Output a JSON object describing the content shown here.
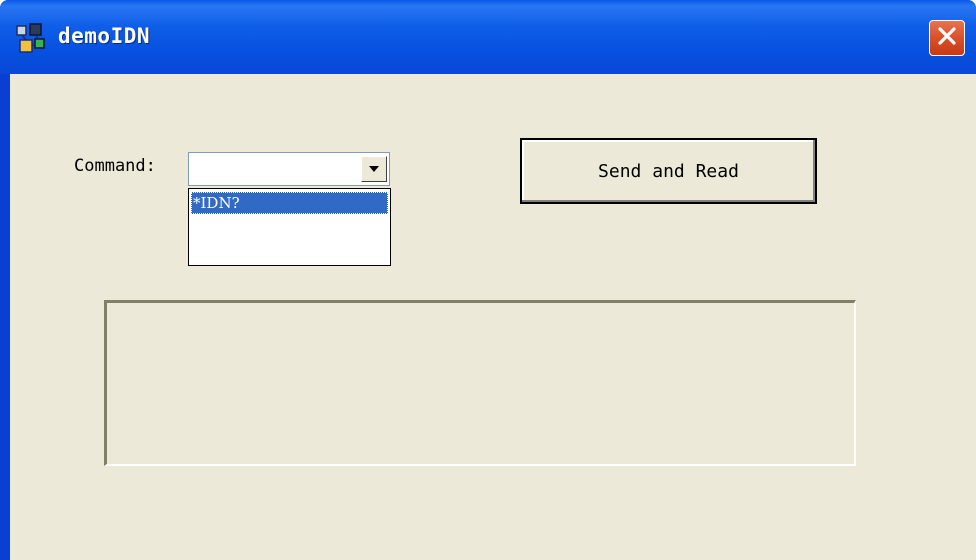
{
  "window": {
    "title": "demoIDN",
    "close_symbol": "×"
  },
  "form": {
    "command_label": "Command:",
    "command_value": "",
    "dropdown_options": [
      "*IDN?"
    ],
    "selected_option": "*IDN?",
    "send_button_label": "Send and Read",
    "output_text": ""
  },
  "colors": {
    "titlebar": "#0a58e8",
    "client_background": "#ece9d8",
    "selection": "#316ac5",
    "close_button": "#d9502a"
  },
  "icons": {
    "app": "app-icon",
    "close": "close-icon",
    "dropdown": "chevron-down-icon"
  }
}
